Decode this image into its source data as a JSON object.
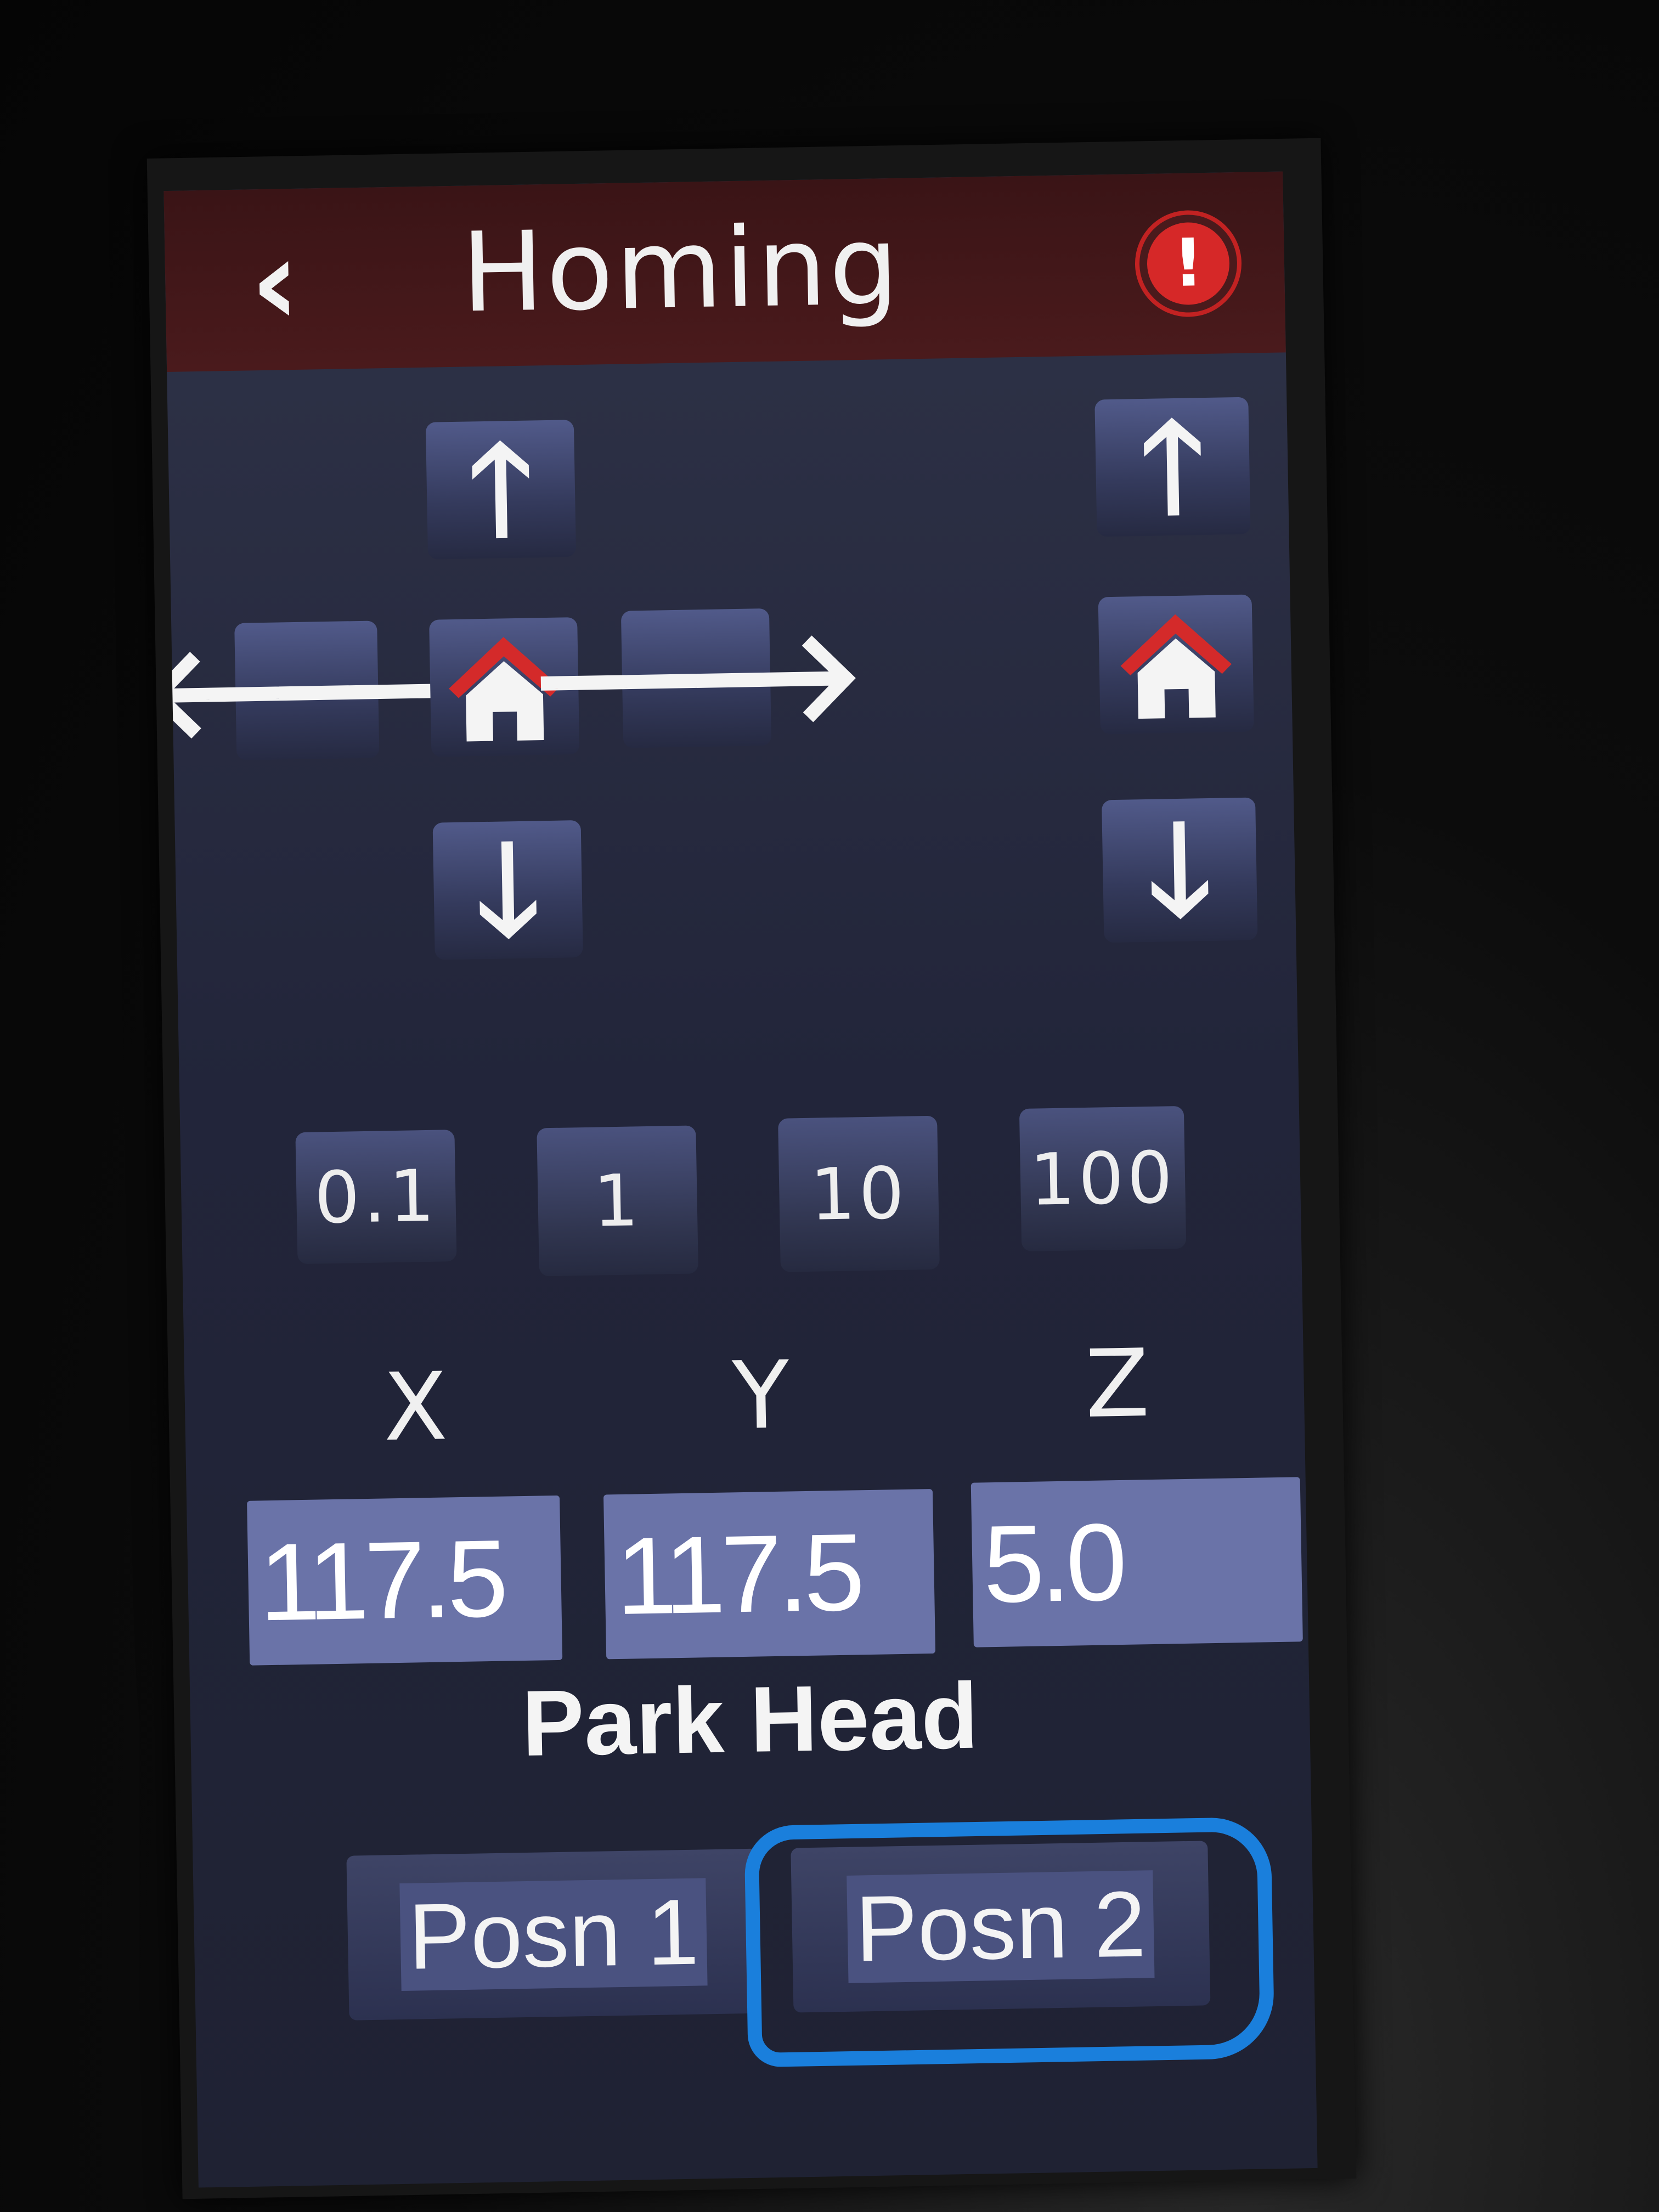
{
  "header": {
    "back_icon": "chevron-left-icon",
    "title": "Homing",
    "alert_icon": "alert-icon",
    "alert_symbol": "!",
    "accent_color": "#4a1a1c",
    "alert_color": "#d62828"
  },
  "xy_jog": {
    "up_symbol": "🡑",
    "left_symbol": "🡐",
    "right_symbol": "🡒",
    "down_symbol": "🡓",
    "home_icon": "home-icon"
  },
  "z_jog": {
    "up_symbol": "🡑",
    "down_symbol": "🡓",
    "home_icon": "home-icon"
  },
  "step_sizes": [
    "0.1",
    "1",
    "10",
    "100"
  ],
  "axes": {
    "x": {
      "label": "X",
      "value": "117.5"
    },
    "y": {
      "label": "Y",
      "value": "117.5"
    },
    "z": {
      "label": "Z",
      "value": "5.0"
    }
  },
  "park_head": {
    "label": "Park Head",
    "buttons": [
      "Posn 1",
      "Posn 2"
    ]
  },
  "annotation_color": "#1a7fdc"
}
